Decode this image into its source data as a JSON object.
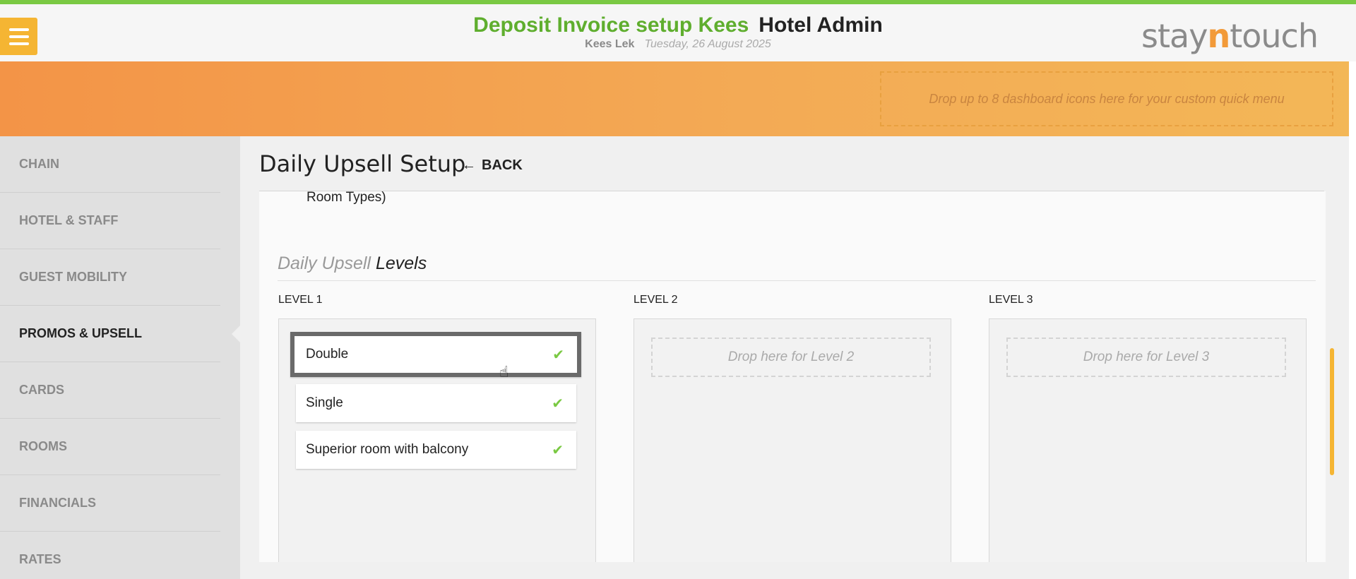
{
  "app": {
    "title_green": "Deposit Invoice setup Kees",
    "title_dark": "Hotel Admin",
    "user": "Kees Lek",
    "date": "Tuesday, 26 August 2025",
    "brand_a": "stay",
    "brand_b": "n",
    "brand_c": "touch"
  },
  "quick_menu": {
    "placeholder": "Drop up to 8 dashboard icons here for your custom quick menu"
  },
  "sidebar": {
    "items": [
      {
        "label": "CHAIN",
        "active": false
      },
      {
        "label": "HOTEL & STAFF",
        "active": false
      },
      {
        "label": "GUEST MOBILITY",
        "active": false
      },
      {
        "label": "PROMOS & UPSELL",
        "active": true
      },
      {
        "label": "CARDS",
        "active": false
      },
      {
        "label": "ROOMS",
        "active": false
      },
      {
        "label": "FINANCIALS",
        "active": false
      },
      {
        "label": "RATES",
        "active": false
      }
    ]
  },
  "page": {
    "title": "Daily Upsell Setup",
    "back_label": "BACK",
    "room_types_fragment": "Room Types)",
    "section_heading_light": "Daily Upsell",
    "section_heading_dark": "Levels"
  },
  "levels": [
    {
      "label": "LEVEL 1",
      "rooms": [
        {
          "name": "Double",
          "checked": true,
          "selected": true
        },
        {
          "name": "Single",
          "checked": true,
          "selected": false
        },
        {
          "name": "Superior room with balcony",
          "checked": true,
          "selected": false
        }
      ]
    },
    {
      "label": "LEVEL 2",
      "drop_text": "Drop here for Level 2",
      "rooms": []
    },
    {
      "label": "LEVEL 3",
      "drop_text": "Drop here for Level 3",
      "rooms": []
    }
  ],
  "icons": {
    "menu": "hamburger-icon",
    "back": "arrow-left-icon",
    "check": "checkmark-icon",
    "cursor": "hand-cursor-icon"
  },
  "colors": {
    "accent_green": "#7ac943",
    "brand_orange": "#f29a39",
    "menu_yellow": "#f5b533"
  }
}
